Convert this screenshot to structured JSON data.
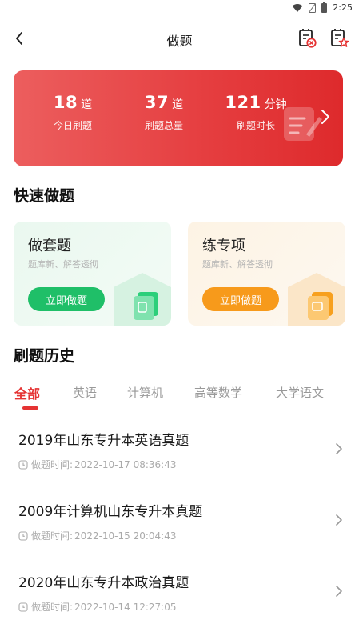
{
  "status_bar": {
    "time": "2:25"
  },
  "header": {
    "title": "做题"
  },
  "stats": [
    {
      "value": "18",
      "unit": "道",
      "label": "今日刷题"
    },
    {
      "value": "37",
      "unit": "道",
      "label": "刷题总量"
    },
    {
      "value": "121",
      "unit": "分钟",
      "label": "刷题时长"
    }
  ],
  "quick": {
    "title": "快速做题",
    "cards": [
      {
        "title": "做套题",
        "subtitle": "题库新、解答透彻",
        "button": "立即做题"
      },
      {
        "title": "练专项",
        "subtitle": "题库新、解答透彻",
        "button": "立即做题"
      }
    ]
  },
  "history": {
    "title": "刷题历史",
    "tabs": [
      "全部",
      "英语",
      "计算机",
      "高等数学",
      "大学语文"
    ],
    "active_tab": "全部",
    "time_label": "做题时间:",
    "records": [
      {
        "title": "2019年山东专升本英语真题",
        "time": "2022-10-17 08:36:43"
      },
      {
        "title": "2009年计算机山东专升本真题",
        "time": "2022-10-15 20:04:43"
      },
      {
        "title": "2020年山东专升本政治真题",
        "time": "2022-10-14 12:27:05"
      }
    ]
  },
  "colors": {
    "accent": "#e53333",
    "green": "#1fbf68",
    "orange": "#f79a1b"
  }
}
